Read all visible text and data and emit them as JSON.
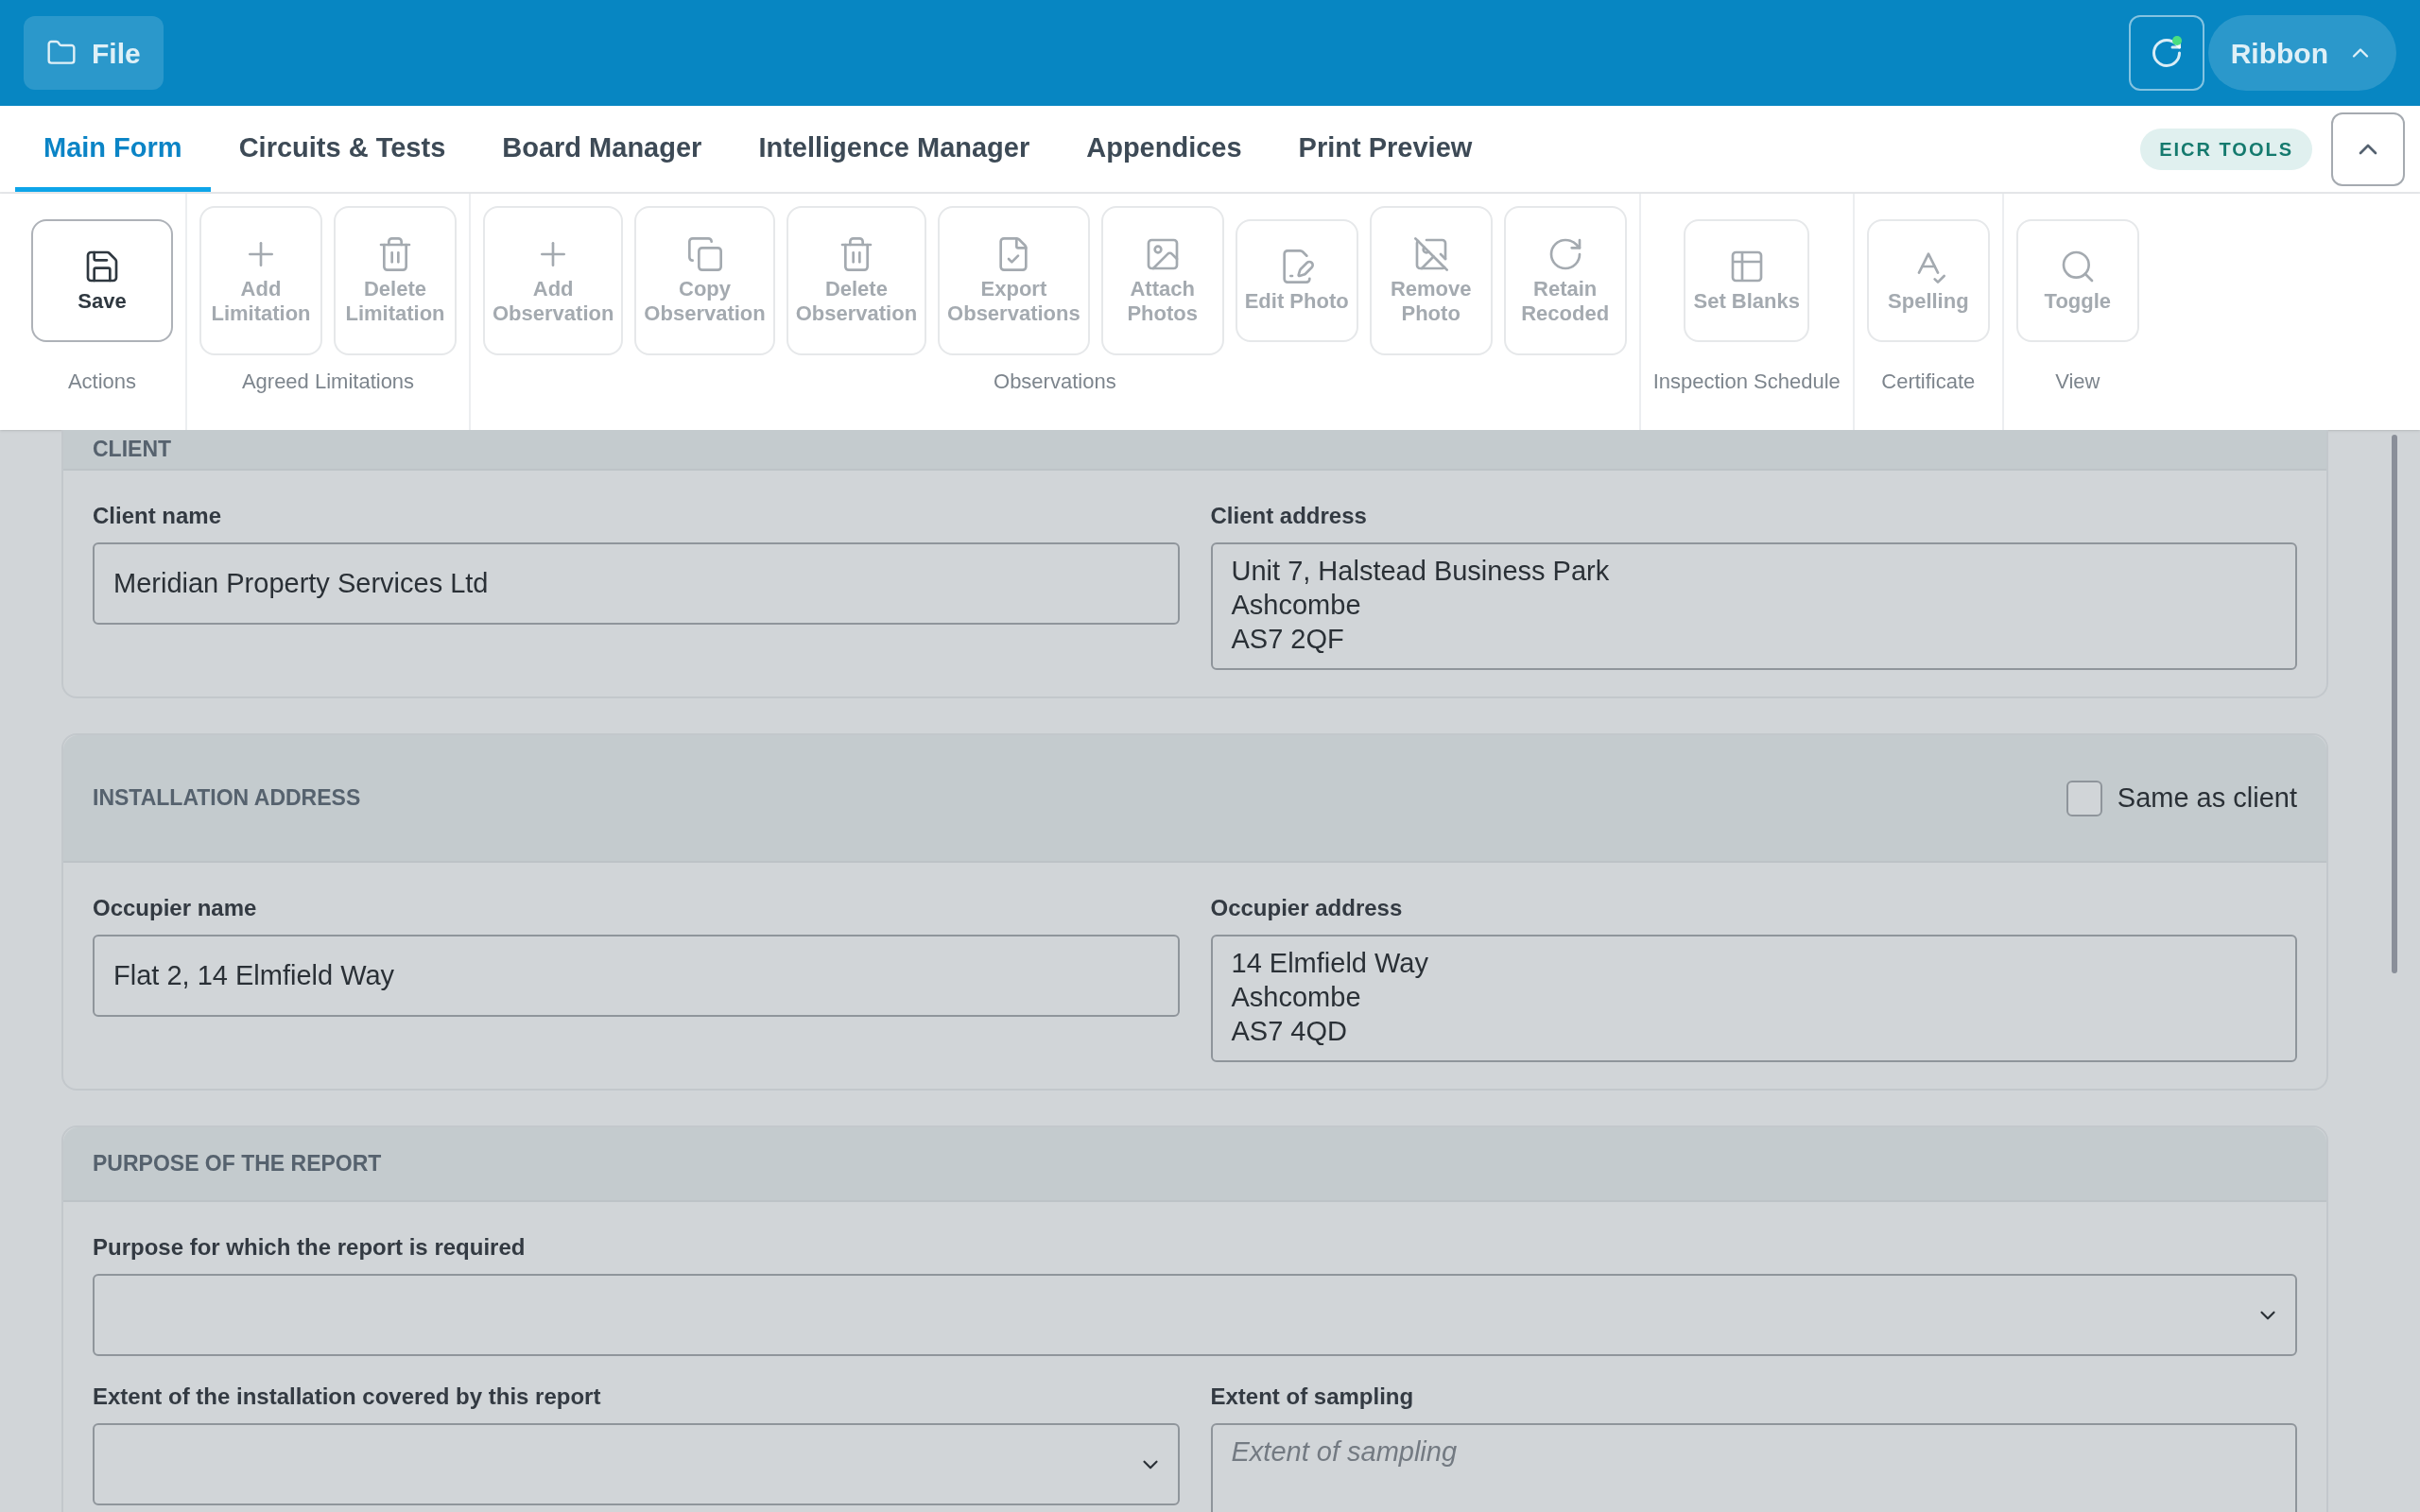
{
  "top_bar": {
    "file_button": "File",
    "ribbon_button": "Ribbon",
    "sync_status": {
      "online": true
    }
  },
  "tabs": [
    {
      "label": "Main Form",
      "selected": true
    },
    {
      "label": "Circuits & Tests",
      "selected": false
    },
    {
      "label": "Board Manager",
      "selected": false
    },
    {
      "label": "Intelligence Manager",
      "selected": false
    },
    {
      "label": "Appendices",
      "selected": false
    },
    {
      "label": "Print Preview",
      "selected": false
    }
  ],
  "tools_badge": "EICR TOOLS",
  "ribbon_groups": [
    {
      "label": "Actions",
      "buttons": [
        {
          "label": "Save",
          "disabled": false
        }
      ]
    },
    {
      "label": "Agreed Limitations",
      "buttons": [
        {
          "label": "Add Limitation",
          "disabled": true
        },
        {
          "label": "Delete Limitation",
          "disabled": true
        }
      ]
    },
    {
      "label": "Observations",
      "buttons": [
        {
          "label": "Add Observation",
          "disabled": true
        },
        {
          "label": "Copy Observation",
          "disabled": true
        },
        {
          "label": "Delete Observation",
          "disabled": true
        },
        {
          "label": "Export Observations",
          "disabled": true
        },
        {
          "label": "Attach Photos",
          "disabled": true
        },
        {
          "label": "Edit Photo",
          "disabled": true
        },
        {
          "label": "Remove Photo",
          "disabled": true
        },
        {
          "label": "Retain Recoded",
          "disabled": true
        }
      ]
    },
    {
      "label": "Inspection Schedule",
      "buttons": [
        {
          "label": "Set Blanks",
          "disabled": true
        }
      ]
    },
    {
      "label": "Certificate",
      "buttons": [
        {
          "label": "Spelling",
          "disabled": true
        }
      ]
    },
    {
      "label": "View",
      "buttons": [
        {
          "label": "Toggle",
          "disabled": true
        }
      ]
    }
  ],
  "sections": [
    {
      "title": "CLIENT",
      "rows": [
        [
          {
            "kind": "text",
            "label": "Client name",
            "value": "Meridian Property Services Ltd"
          },
          {
            "kind": "textarea",
            "label": "Client address",
            "value": "Unit 7, Halstead Business Park\nAshcombe\nAS7 2QF"
          }
        ]
      ]
    },
    {
      "title": "INSTALLATION ADDRESS",
      "same_as_client": {
        "label": "Same as client",
        "checked": false
      },
      "rows": [
        [
          {
            "kind": "text",
            "label": "Occupier name",
            "value": "Flat 2, 14 Elmfield Way"
          },
          {
            "kind": "textarea",
            "label": "Occupier address",
            "value": "14 Elmfield Way\nAshcombe\nAS7 4QD"
          }
        ]
      ]
    },
    {
      "title": "PURPOSE OF THE REPORT",
      "rows": [
        [
          {
            "kind": "select",
            "label": "Purpose for which the report is required"
          }
        ],
        [
          {
            "kind": "select",
            "label": "Extent of the installation covered by this report"
          },
          {
            "kind": "textarea",
            "label": "Extent of sampling",
            "placeholder": "Extent of sampling"
          }
        ]
      ]
    }
  ]
}
